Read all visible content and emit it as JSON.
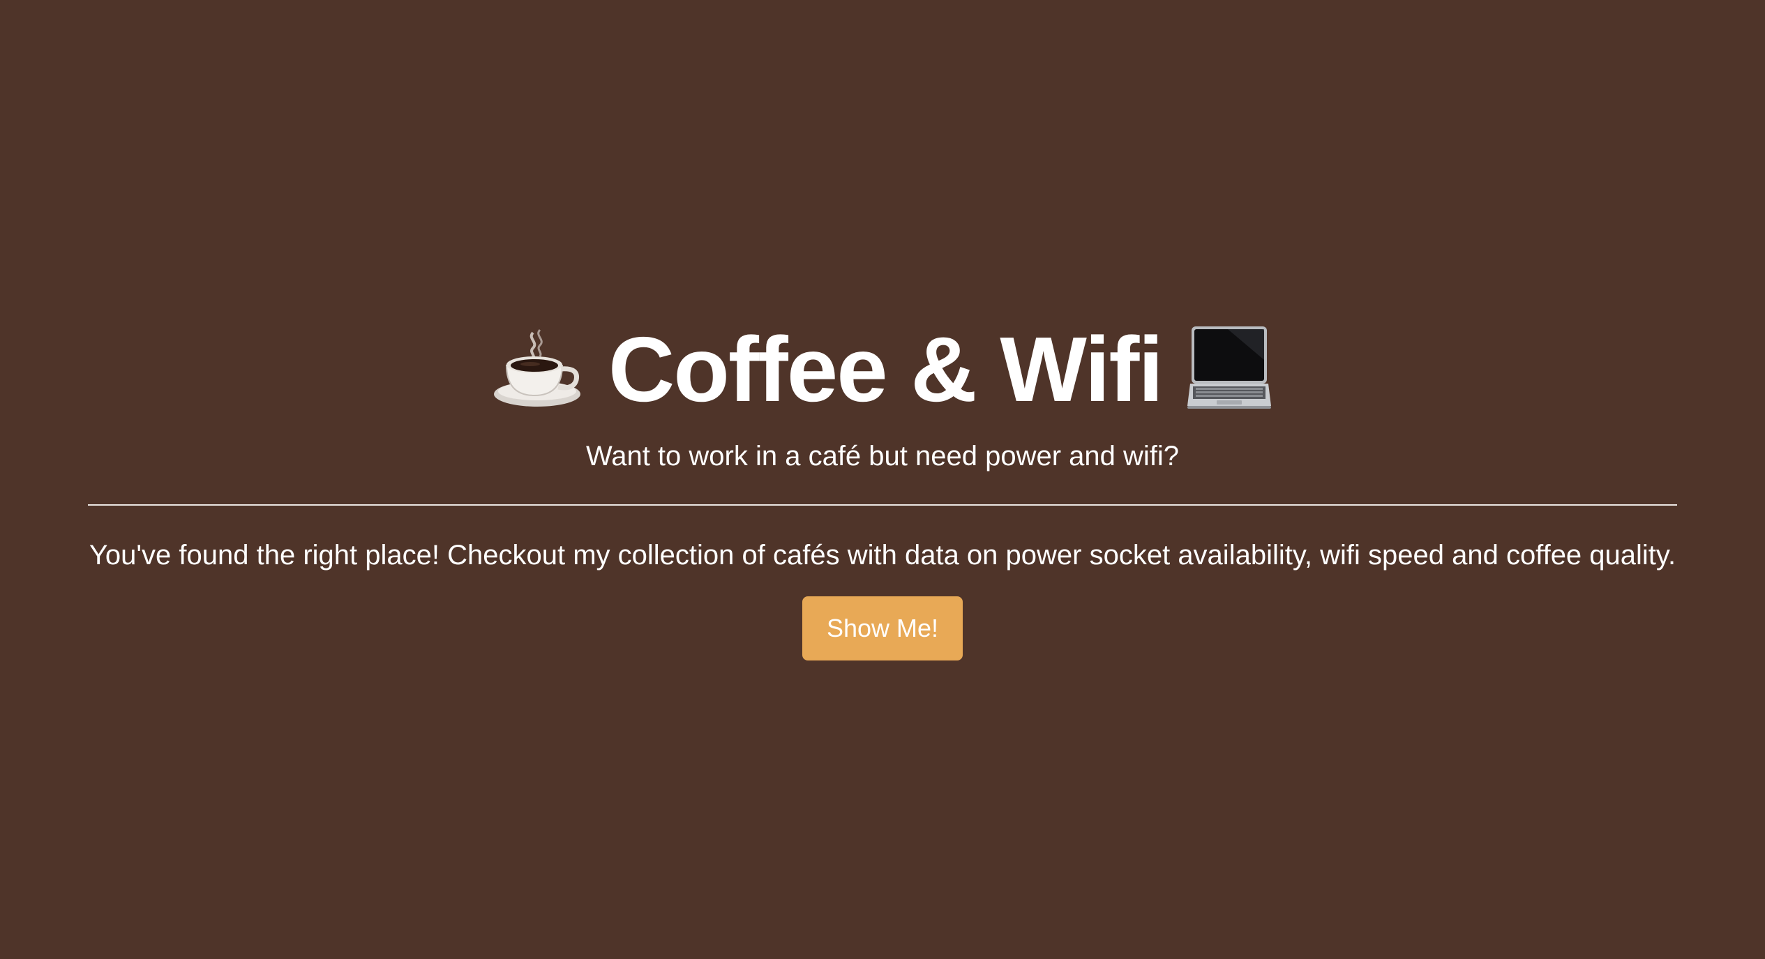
{
  "hero": {
    "title": "Coffee & Wifi",
    "title_icon_left": "coffee-cup-icon",
    "title_icon_right": "laptop-icon",
    "subtitle": "Want to work in a café but need power and wifi?",
    "lead": "You've found the right place! Checkout my collection of cafés with data on power socket availability, wifi speed and coffee quality.",
    "cta_label": "Show Me!"
  },
  "colors": {
    "background": "#4f3429",
    "text": "#ffffff",
    "button": "#e8a956"
  }
}
